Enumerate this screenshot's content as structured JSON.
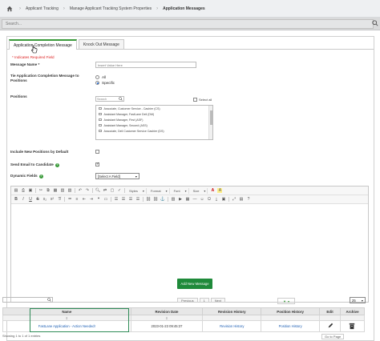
{
  "breadcrumb": {
    "items": [
      "Applicant Tracking",
      "Manage Applicant Tracking System Properties",
      "Application Messages"
    ]
  },
  "search": {
    "placeholder": "Search..."
  },
  "tabs": [
    {
      "label": "Application Completion Message",
      "active": true
    },
    {
      "label": "Knock Out Message",
      "active": false
    }
  ],
  "form": {
    "required_note": "* Indicates Required Field",
    "message_name_label": "Message Name *",
    "message_name_placeholder": "Insert Value Here",
    "tie_label_line1": "Tie Application Completion Message to",
    "tie_label_line2": "Positions",
    "tie_options": [
      {
        "label": "All",
        "selected": false
      },
      {
        "label": "Specific",
        "selected": true
      }
    ],
    "positions_label": "Positions",
    "positions_search_placeholder": "Search",
    "select_all_label": "Select all",
    "positions": [
      "Associate, Customer Service - Cashier (CS)",
      "Assistant Manager, FastLane Deli (DM)",
      "Assistant Manager, First (ASF)",
      "Assistant Manager, Second (ASS)",
      "Associate, Deli Customer Service Cashier (DS)"
    ],
    "include_new_label": "Include New Positions by Default",
    "include_new_checked": false,
    "send_email_label": "Send Email to Candidate",
    "send_email_checked": true,
    "dynamic_fields_label": "Dynamic Fields",
    "dynamic_fields_value": "[Select A Field]"
  },
  "editor": {
    "styles_label": "Styles",
    "format_label": "Format",
    "font_label": "Font",
    "size_label": "Size"
  },
  "add_button": "Add New Message",
  "grid": {
    "pager_prev": "Previous",
    "pager_page": "1",
    "pager_next": "Next",
    "page_size": "25",
    "columns": [
      "Name",
      "Revision Date",
      "Revision History",
      "Position History",
      "Edit",
      "Archive"
    ],
    "rows": [
      {
        "name": "FastLane Application - Action Needed!",
        "revision_date": "2023-01-23 09:45:37",
        "revision_history": "Revision History",
        "position_history": "Position History"
      }
    ],
    "footer_left": "Showing 1 to 1 of 1 entries",
    "footer_right": "Go to Page"
  },
  "colors": {
    "accent": "#1f8a3a",
    "link": "#1e5fb3",
    "required": "#dd2222"
  }
}
